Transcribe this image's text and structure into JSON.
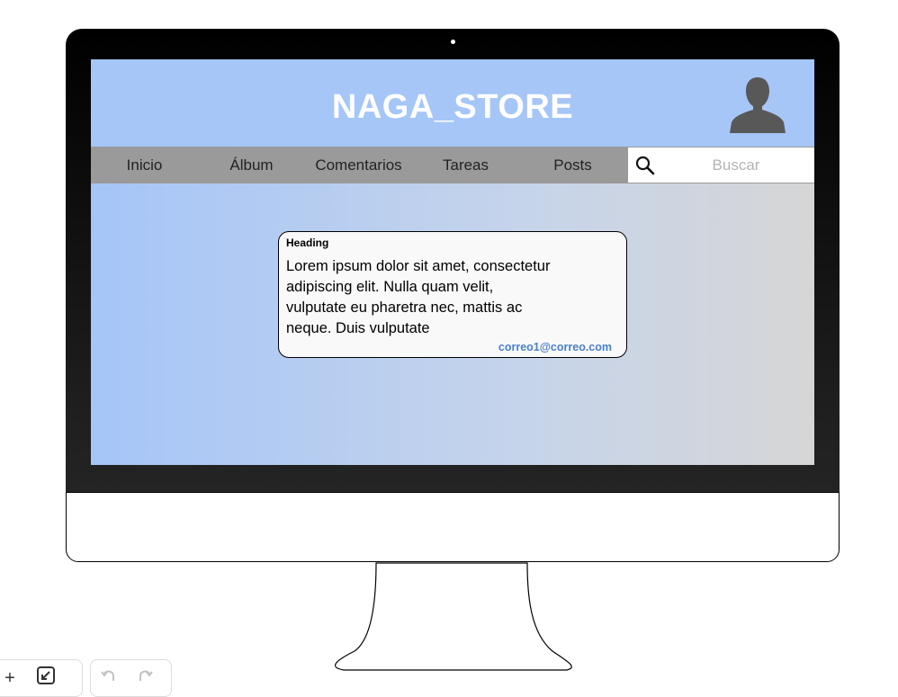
{
  "header": {
    "title": "NAGA_STORE",
    "avatar_icon": "user-avatar-icon"
  },
  "nav": {
    "items": [
      {
        "label": "Inicio"
      },
      {
        "label": "Álbum"
      },
      {
        "label": "Comentarios"
      },
      {
        "label": "Tareas"
      },
      {
        "label": "Posts"
      }
    ]
  },
  "search": {
    "icon": "search-icon",
    "placeholder": "Buscar"
  },
  "post_card": {
    "heading": "Heading",
    "body": "Lorem ipsum dolor sit amet, consectetur adipiscing elit. Nulla quam velit, vulputate eu pharetra nec, mattis ac neque. Duis vulputate",
    "email": "correo1@correo.com"
  },
  "toolbar": {
    "zoom_in_label": "+",
    "fit_icon": "fit-screen-icon",
    "undo_icon": "undo-icon",
    "redo_icon": "redo-icon"
  },
  "colors": {
    "header_bg": "#a6c6f8",
    "nav_bg": "#9a9a9a",
    "email_link": "#4a7fd0"
  }
}
